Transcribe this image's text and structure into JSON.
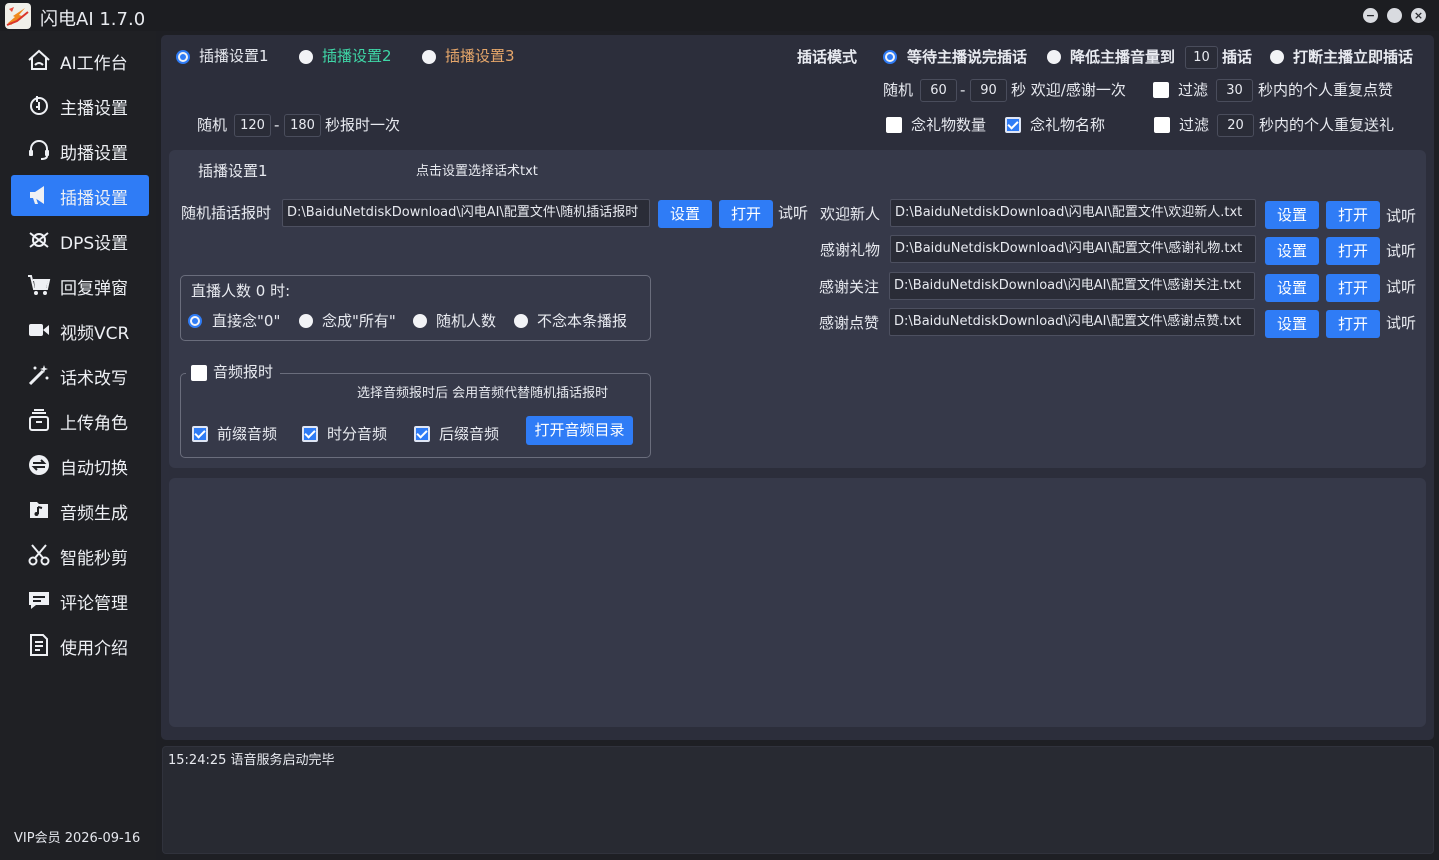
{
  "window": {
    "title": "闪电AI 1.7.0",
    "controls": [
      "minimize-icon",
      "maximize-icon",
      "close-icon"
    ]
  },
  "sidebar": {
    "items": [
      {
        "label": "AI工作台",
        "icon": "home-icon"
      },
      {
        "label": "主播设置",
        "icon": "anchor-icon"
      },
      {
        "label": "助播设置",
        "icon": "headset-icon"
      },
      {
        "label": "插播设置",
        "icon": "megaphone-icon",
        "active": true
      },
      {
        "label": "DPS设置",
        "icon": "dps-icon"
      },
      {
        "label": "回复弹窗",
        "icon": "cart-icon"
      },
      {
        "label": "视频VCR",
        "icon": "video-icon"
      },
      {
        "label": "话术改写",
        "icon": "magic-wand-icon"
      },
      {
        "label": "上传角色",
        "icon": "upload-box-icon"
      },
      {
        "label": "自动切换",
        "icon": "switch-icon"
      },
      {
        "label": "音频生成",
        "icon": "music-file-icon"
      },
      {
        "label": "智能秒剪",
        "icon": "scissors-icon"
      },
      {
        "label": "评论管理",
        "icon": "comment-icon"
      },
      {
        "label": "使用介绍",
        "icon": "document-icon"
      }
    ],
    "vip": "VIP会员  2026-09-16"
  },
  "top": {
    "presets": [
      {
        "label": "插播设置1",
        "selected": true
      },
      {
        "label": "插播设置2",
        "selected": false
      },
      {
        "label": "插播设置3",
        "selected": false
      }
    ],
    "random_report": {
      "prefix": "随机",
      "min": "120",
      "dash": "-",
      "max": "180",
      "suffix": "秒报时一次"
    },
    "insert_mode": {
      "label": "插话模式",
      "options": [
        {
          "label": "等待主播说完插话",
          "selected": true
        },
        {
          "label": "降低主播音量到",
          "selected": false
        },
        {
          "label": "打断主播立即插话",
          "selected": false
        }
      ],
      "volume": "10",
      "volume_suffix": "插话"
    },
    "welcome_random": {
      "prefix": "随机",
      "min": "60",
      "dash": "-",
      "max": "90",
      "suffix": "秒 欢迎/感谢一次"
    },
    "filter_like": {
      "label": "过滤",
      "value": "30",
      "suffix": "秒内的个人重复点赞",
      "checked": false
    },
    "gift_count": {
      "label": "念礼物数量",
      "checked": false
    },
    "gift_name": {
      "label": "念礼物名称",
      "checked": true
    },
    "filter_gift": {
      "label": "过滤",
      "value": "20",
      "suffix": "秒内的个人重复送礼",
      "checked": false
    }
  },
  "panel": {
    "title": "插播设置1",
    "hint": "点击设置选择话术txt",
    "random_insert": {
      "label": "随机插话报时",
      "path": "D:\\BaiduNetdiskDownload\\闪电AI\\配置文件\\随机插话报时",
      "set": "设置",
      "open": "打开",
      "listen": "试听"
    },
    "rows": [
      {
        "label": "欢迎新人",
        "path": "D:\\BaiduNetdiskDownload\\闪电AI\\配置文件\\欢迎新人.txt",
        "set": "设置",
        "open": "打开",
        "listen": "试听"
      },
      {
        "label": "感谢礼物",
        "path": "D:\\BaiduNetdiskDownload\\闪电AI\\配置文件\\感谢礼物.txt",
        "set": "设置",
        "open": "打开",
        "listen": "试听"
      },
      {
        "label": "感谢关注",
        "path": "D:\\BaiduNetdiskDownload\\闪电AI\\配置文件\\感谢关注.txt",
        "set": "设置",
        "open": "打开",
        "listen": "试听"
      },
      {
        "label": "感谢点赞",
        "path": "D:\\BaiduNetdiskDownload\\闪电AI\\配置文件\\感谢点赞.txt",
        "set": "设置",
        "open": "打开",
        "listen": "试听"
      }
    ],
    "zero_viewers": {
      "title": "直播人数 0 时:",
      "options": [
        {
          "label": "直接念\"0\"",
          "selected": true
        },
        {
          "label": "念成\"所有\"",
          "selected": false
        },
        {
          "label": "随机人数",
          "selected": false
        },
        {
          "label": "不念本条播报",
          "selected": false
        }
      ]
    },
    "audio_report": {
      "label": "音频报时",
      "checked": false,
      "note": "选择音频报时后 会用音频代替随机插话报时",
      "options": [
        {
          "label": "前缀音频",
          "checked": true
        },
        {
          "label": "时分音频",
          "checked": true
        },
        {
          "label": "后缀音频",
          "checked": true
        }
      ],
      "open_dir": "打开音频目录"
    }
  },
  "log": {
    "lines": [
      "15:24:25 语音服务启动完毕"
    ]
  },
  "colors": {
    "accent": "#2f7cf6",
    "green": "#3fd7a7",
    "orange": "#e5a66a",
    "bg": "#1e1f24",
    "panel": "#363949"
  }
}
